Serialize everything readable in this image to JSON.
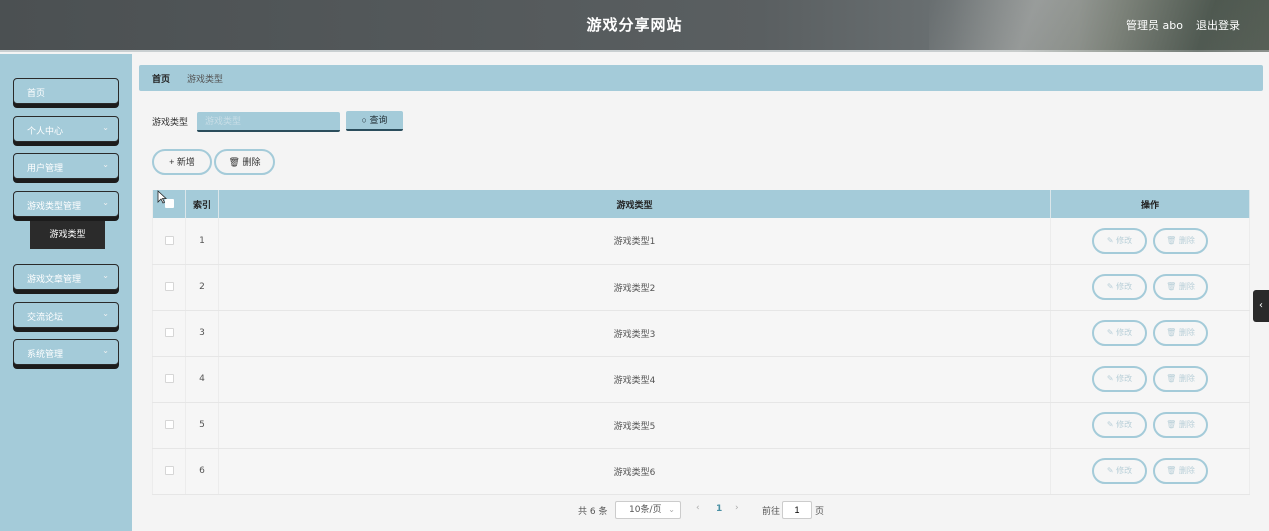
{
  "header": {
    "title": "游戏分享网站",
    "user": "管理员 abo",
    "logout": "退出登录"
  },
  "sidebar": {
    "items": [
      {
        "label": "首页",
        "has_chevron": false
      },
      {
        "label": "个人中心",
        "has_chevron": true
      },
      {
        "label": "用户管理",
        "has_chevron": true
      },
      {
        "label": "游戏类型管理",
        "has_chevron": true
      },
      {
        "label": "游戏文章管理",
        "has_chevron": true
      },
      {
        "label": "交流论坛",
        "has_chevron": true
      },
      {
        "label": "系统管理",
        "has_chevron": true
      }
    ],
    "submenu": {
      "label": "游戏类型"
    },
    "chevron_icon": "chevron-down-icon"
  },
  "breadcrumb": {
    "home": "首页",
    "current": "游戏类型"
  },
  "search": {
    "label": "游戏类型",
    "placeholder": "游戏类型",
    "button": "查询"
  },
  "actions": {
    "add": "新增",
    "delete": "删除"
  },
  "table": {
    "headers": {
      "index": "索引",
      "type": "游戏类型",
      "ops": "操作"
    },
    "rows": [
      {
        "index": "1",
        "type": "游戏类型1"
      },
      {
        "index": "2",
        "type": "游戏类型2"
      },
      {
        "index": "3",
        "type": "游戏类型3"
      },
      {
        "index": "4",
        "type": "游戏类型4"
      },
      {
        "index": "5",
        "type": "游戏类型5"
      },
      {
        "index": "6",
        "type": "游戏类型6"
      }
    ],
    "row_actions": {
      "edit": "修改",
      "delete": "删除"
    }
  },
  "pagination": {
    "total": "共 6 条",
    "page_size": "10条/页",
    "current_page": "1",
    "goto_label": "前往",
    "goto_value": "1",
    "goto_unit": "页"
  },
  "colors": {
    "accent": "#a4cbd9",
    "dark": "#2b2b2b"
  }
}
